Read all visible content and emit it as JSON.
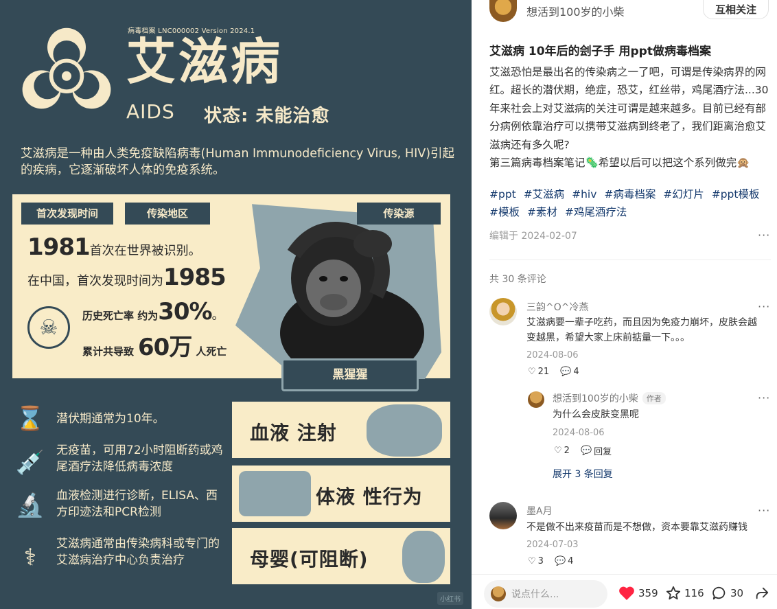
{
  "poster": {
    "meta": "病毒档案  LNC000002  Version 2024.1",
    "title": "艾滋病",
    "subtitle": "AIDS",
    "status": "状态: 未能治愈",
    "intro": "艾滋病是一种由人类免疫缺陷病毒(Human Immunodeficiency Virus, HIV)引起的疾病，它逐渐破坏人体的免疫系统。",
    "tags": [
      "首次发现时间",
      "传染地区",
      "传染源"
    ],
    "line1_big": "1981",
    "line1_text": "首次在世界被识别。",
    "line2_text": "在中国，首次发现时间为",
    "line2_big": "1985",
    "line3_prefix": "历史死亡率 约为",
    "line3_big": "30%",
    "line3_suffix": "。",
    "line4_prefix": "累计共导致",
    "line4_big": "60万",
    "line4_suffix": "人死亡",
    "source_label": "黑猩猩",
    "features": [
      "潜伏期通常为10年。",
      "无疫苗，可用72小时阻断药或鸡尾酒疗法降低病毒浓度",
      "血液检测进行诊断，ELISA、西方印迹法和PCR检测",
      "艾滋病通常由传染病科或专门的艾滋病治疗中心负责治疗"
    ],
    "routes": [
      "血液 注射",
      "体液 性行为",
      "母婴(可阻断)"
    ],
    "watermark": "小红书"
  },
  "author": {
    "name": "想活到100岁的小柴",
    "follow_label": "互相关注"
  },
  "post": {
    "title": "艾滋病 10年后的刽子手 用ppt做病毒档案",
    "paragraphs": [
      "艾滋恐怕是最出名的传染病之一了吧，可谓是传染病界的网红。超长的潜伏期，绝症，恐艾，红丝带，鸡尾酒疗法...30年来社会上对艾滋病的关注可谓是越来越多。目前已经有部分病例依靠治疗可以携带艾滋病到终老了，我们距离治愈艾滋病还有多久呢?",
      "第三篇病毒档案笔记🦠希望以后可以把这个系列做完🙊"
    ],
    "hashtags": [
      "#ppt",
      "#艾滋病",
      "#hiv",
      "#病毒档案",
      "#幻灯片",
      "#ppt模板",
      "#模板",
      "#素材",
      "#鸡尾酒疗法"
    ],
    "edit_date": "编辑于 2024-02-07",
    "comment_count": "共 30 条评论"
  },
  "comments": [
    {
      "name": "三韵^O^冷燕",
      "text": "艾滋病要一辈子吃药，而且因为免疫力崩坏，皮肤会越变越黑，希望大家上床前掂量一下。。。",
      "date": "2024-08-06",
      "likes": "21",
      "replies": "4"
    },
    {
      "name": "想活到100岁的小柴",
      "author_tag": "作者",
      "text": "为什么会皮肤变黑呢",
      "date": "2024-08-06",
      "likes": "2",
      "reply_label": "回复"
    },
    {
      "name": "墨A月",
      "text": "不是做不出来疫苗而是不想做，资本要靠艾滋药赚钱",
      "date": "2024-07-03",
      "likes": "3",
      "replies": "4"
    }
  ],
  "expand_replies": "展开 3 条回复",
  "bottom_bar": {
    "placeholder": "说点什么...",
    "likes": "359",
    "stars": "116",
    "comments": "30"
  },
  "colors": {
    "poster_bg": "#344a56",
    "cream": "#f6e9c8",
    "panel": "#f9ecc8",
    "slate": "#8fa5ac",
    "like_red": "#ff2442",
    "link_blue": "#13386c"
  },
  "icons": [
    "biohazard-icon",
    "skull-icon",
    "virus-hourglass-icon",
    "syringe-icon",
    "microscope-icon",
    "doctor-icon",
    "heart-icon",
    "star-icon",
    "chat-bubble-icon",
    "share-icon",
    "more-dots-icon"
  ]
}
